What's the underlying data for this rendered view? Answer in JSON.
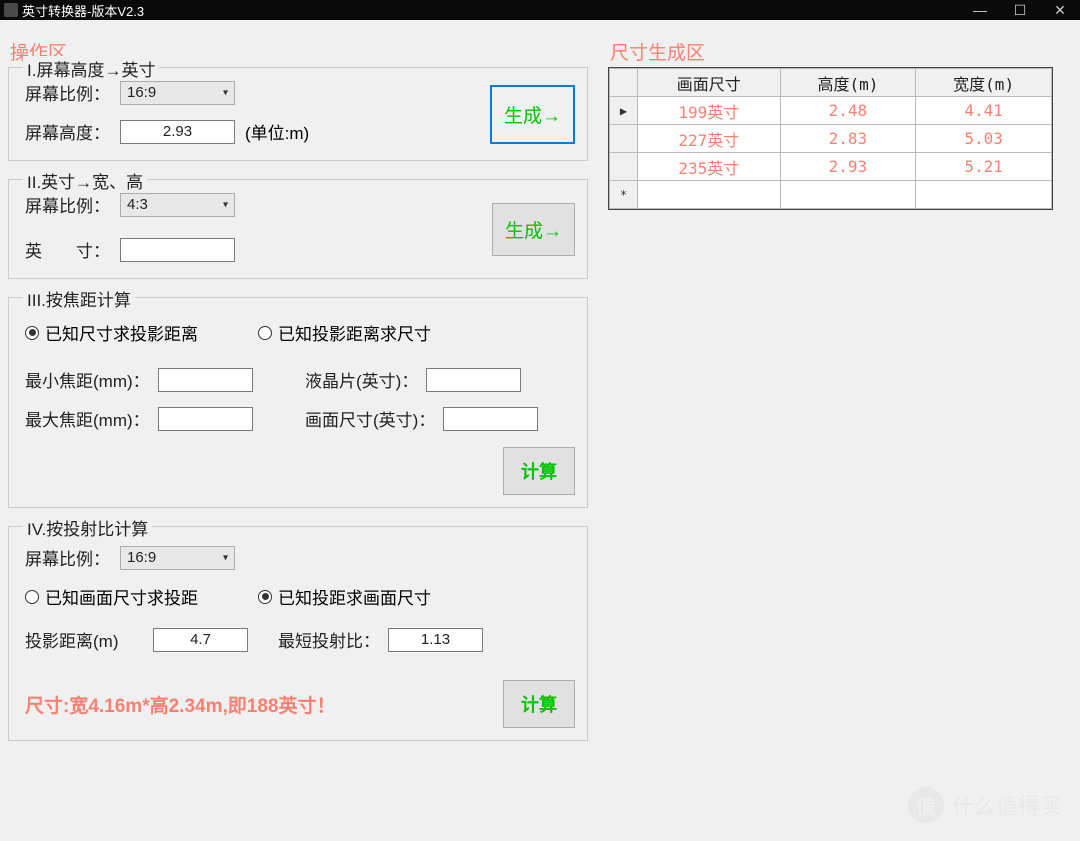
{
  "titlebar": {
    "title": "英寸转换器-版本V2.3"
  },
  "left": {
    "group_label": "操作区",
    "sec1": {
      "legend": "I.屏幕高度→英寸",
      "ratio_label": "屏幕比例：",
      "ratio_value": "16:9",
      "height_label": "屏幕高度：",
      "height_value": "2.93",
      "unit": "(单位:m)",
      "gen_btn": "生成→"
    },
    "sec2": {
      "legend": "II.英寸→宽、高",
      "ratio_label": "屏幕比例：",
      "ratio_value": "4:3",
      "inch_label": "英　　寸：",
      "inch_value": "",
      "gen_btn": "生成→"
    },
    "sec3": {
      "legend": "III.按焦距计算",
      "radio_a": "已知尺寸求投影距离",
      "radio_b": "已知投影距离求尺寸",
      "minf_label": "最小焦距(mm)：",
      "minf_value": "",
      "lcd_label": "液晶片(英寸)：",
      "lcd_value": "",
      "maxf_label": "最大焦距(mm)：",
      "maxf_value": "",
      "size_label": "画面尺寸(英寸)：",
      "size_value": "",
      "calc_btn": "计算"
    },
    "sec4": {
      "legend": "IV.按投射比计算",
      "ratio_label": "屏幕比例：",
      "ratio_value": "16:9",
      "radio_a": "已知画面尺寸求投距",
      "radio_b": "已知投距求画面尺寸",
      "dist_label": "投影距离(m)",
      "dist_value": "4.7",
      "throw_label": "最短投射比：",
      "throw_value": "1.13",
      "calc_btn": "计算",
      "result": "尺寸:宽4.16m*高2.34m,即188英寸！"
    }
  },
  "right": {
    "group_label": "尺寸生成区",
    "headers": {
      "size": "画面尺寸",
      "height": "高度(m)",
      "width": "宽度(m)"
    },
    "rows": [
      {
        "size": "199英寸",
        "height": "2.48",
        "width": "4.41",
        "selected": true
      },
      {
        "size": "227英寸",
        "height": "2.83",
        "width": "5.03",
        "selected": false
      },
      {
        "size": "235英寸",
        "height": "2.93",
        "width": "5.21",
        "selected": false
      }
    ]
  },
  "watermark": {
    "badge": "值",
    "text": "什么值得买"
  }
}
